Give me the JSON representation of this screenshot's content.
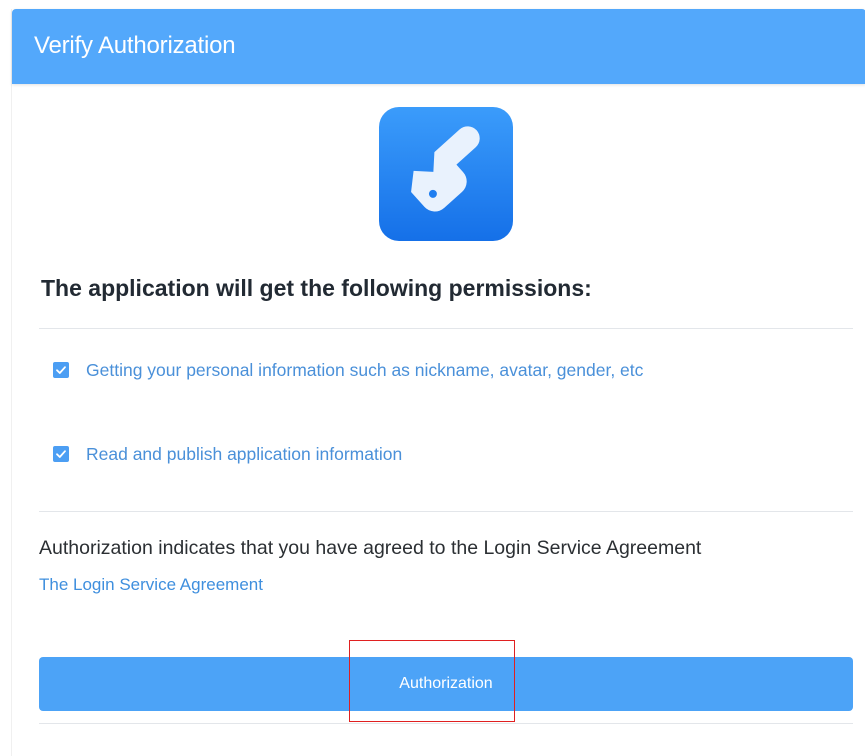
{
  "header": {
    "title": "Verify Authorization",
    "background_color": "#53a8fb"
  },
  "app_logo": {
    "icon": "app-logo-icon",
    "color": "#1f7ef0"
  },
  "permissions": {
    "title": "The application will get the following permissions:",
    "items": [
      {
        "label": "Getting your personal information such as nickname, avatar, gender, etc",
        "checked": true
      },
      {
        "label": "Read and publish application information",
        "checked": true
      }
    ]
  },
  "agreement": {
    "text": "Authorization indicates that you have agreed to the Login Service Agreement",
    "link_label": "The Login Service Agreement"
  },
  "actions": {
    "authorize_label": "Authorization",
    "button_color": "#4ca3f7"
  },
  "annotation": {
    "highlight_color": "#e02020"
  }
}
